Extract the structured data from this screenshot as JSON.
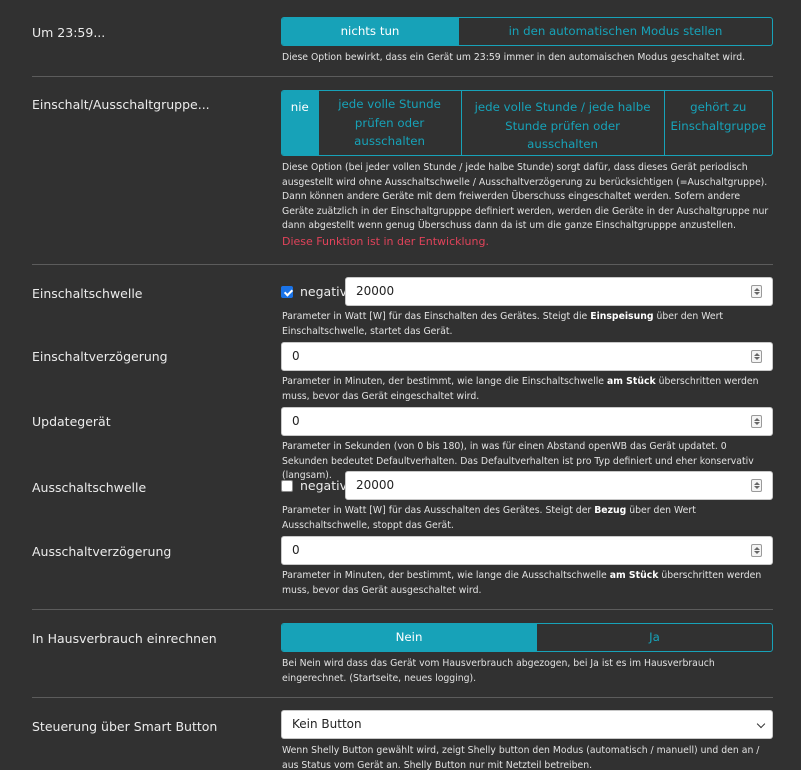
{
  "auto_mode": {
    "label": "Um 23:59...",
    "options": [
      "nichts tun",
      "in den automatischen Modus stellen"
    ],
    "selected": "nichts tun",
    "help": "Diese Option bewirkt, dass ein Gerät um 23:59 immer in den automaischen Modus geschaltet wird."
  },
  "switch_group": {
    "label": "Einschalt/Ausschaltgruppe...",
    "options": [
      "nie",
      "jede volle Stunde prüfen oder ausschalten",
      "jede volle Stunde / jede halbe Stunde prüfen oder ausschalten",
      "gehört zu Einschaltgruppe"
    ],
    "selected": "nie",
    "help": "Diese Option (bei jeder vollen Stunde / jede halbe Stunde) sorgt dafür, dass dieses Gerät periodisch ausgestellt wird ohne Ausschaltschwelle / Ausschaltverzögerung zu berücksichtigen (=Auschaltgruppe). Dann können andere Geräte mit dem freiwerden Überschuss eingeschaltet werden. Sofern andere Geräte zuätzlich in der Einschaltgrupppe definiert werden, werden die Geräte in der Auschaltgruppe nur dann abgestellt wenn genug Überschuss dann da ist um die ganze Einschaltgrupppe anzustellen.",
    "warning": "Diese Funktion ist in der Entwicklung."
  },
  "einschaltschwelle": {
    "label": "Einschaltschwelle",
    "negativ_label": "negativ",
    "negativ_checked": true,
    "value": "20000",
    "help_pre": "Parameter in Watt [W] für das Einschalten des Gerätes. Steigt die ",
    "help_bold": "Einspeisung",
    "help_post": " über den Wert Einschaltschwelle, startet das Gerät."
  },
  "einschaltverzoegerung": {
    "label": "Einschaltverzögerung",
    "value": "0",
    "help_pre": "Parameter in Minuten, der bestimmt, wie lange die Einschaltschwelle ",
    "help_bold": "am Stück",
    "help_post": " überschritten werden muss, bevor das Gerät eingeschaltet wird."
  },
  "updategeraet": {
    "label": "Updategerät",
    "value": "0",
    "help": "Parameter in Sekunden (von 0 bis 180), in was für einen Abstand openWB das Gerät updatet. 0 Sekunden bedeutet Defaultverhalten. Das Defaultverhalten ist pro Typ definiert und eher konservativ (langsam)."
  },
  "ausschaltschwelle": {
    "label": "Ausschaltschwelle",
    "negativ_label": "negativ",
    "negativ_checked": false,
    "value": "20000",
    "help_pre": "Parameter in Watt [W] für das Ausschalten des Gerätes. Steigt der ",
    "help_bold": "Bezug",
    "help_post": " über den Wert Ausschaltschwelle, stoppt das Gerät."
  },
  "ausschaltverzoegerung": {
    "label": "Ausschaltverzögerung",
    "value": "0",
    "help_pre": "Parameter in Minuten, der bestimmt, wie lange die Ausschaltschwelle ",
    "help_bold": "am Stück",
    "help_post": " überschritten werden muss, bevor das Gerät ausgeschaltet wird."
  },
  "hausverbrauch": {
    "label": "In Hausverbrauch einrechnen",
    "options": [
      "Nein",
      "Ja"
    ],
    "selected": "Nein",
    "help": "Bei Nein wird dass das Gerät vom Hausverbrauch abgezogen, bei Ja ist es im Hausverbrauch eingerechnet. (Startseite, neues logging)."
  },
  "smart_button": {
    "label": "Steuerung über Smart Button",
    "selected": "Kein Button",
    "help": "Wenn Shelly Button gewählt wird, zeigt Shelly button den Modus (automatisch / manuell) und den an / aus Status vom Gerät an. Shelly Button nur mit Netzteil betreiben."
  },
  "colors": {
    "accent": "#17a2b8",
    "background": "#313131",
    "warning": "#e0435a",
    "checkbox": "#1a73e8"
  }
}
